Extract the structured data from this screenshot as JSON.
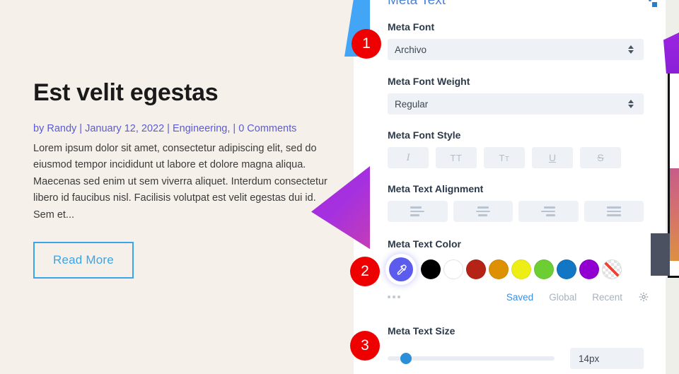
{
  "preview": {
    "post_title": "Est velit egestas",
    "meta_line": "by Randy | January 12, 2022 | Engineering, | 0 Comments",
    "excerpt": "Lorem ipsum dolor sit amet, consectetur adipiscing elit, sed do eiusmod tempor incididunt ut labore et dolore magna aliqua. Maecenas sed enim ut sem viverra aliquet. Interdum consectetur libero id faucibus nisl. Facilisis volutpat est velit egestas dui id. Sem et...",
    "read_more_label": "Read More",
    "background_color": "#f5f0ea",
    "link_color": "#5b5bd6",
    "button_color": "#3aa5e8"
  },
  "panel": {
    "title": "Meta Text",
    "title_color": "#4c82d6",
    "fields": {
      "meta_font": {
        "label": "Meta Font",
        "value": "Archivo"
      },
      "meta_font_weight": {
        "label": "Meta Font Weight",
        "value": "Regular"
      },
      "meta_font_style": {
        "label": "Meta Font Style",
        "options": [
          {
            "name": "italic",
            "glyph": "I"
          },
          {
            "name": "uppercase",
            "glyph": "TT"
          },
          {
            "name": "small-caps",
            "glyph": "T"
          },
          {
            "name": "underline",
            "glyph": "U"
          },
          {
            "name": "strikethrough",
            "glyph": "S"
          }
        ]
      },
      "meta_text_alignment": {
        "label": "Meta Text Alignment",
        "options": [
          "left",
          "center",
          "right",
          "justify"
        ]
      },
      "meta_text_color": {
        "label": "Meta Text Color",
        "swatches": [
          "#000000",
          "#ffffff",
          "#b42316",
          "#dd9000",
          "#eeee17",
          "#6cce32",
          "#1177c4",
          "#9200d1"
        ],
        "transparent_label": "none",
        "eyedropper_color": "#5b5bee",
        "tabs": [
          {
            "label": "Saved",
            "active": true
          },
          {
            "label": "Global",
            "active": false
          },
          {
            "label": "Recent",
            "active": false
          }
        ],
        "settings_icon": "gear-icon",
        "more_icon": "ellipsis-icon"
      },
      "meta_text_size": {
        "label": "Meta Text Size",
        "value": "14px",
        "thumb_percent": 11
      }
    }
  },
  "badges": [
    {
      "number": "1",
      "color": "#ef0000"
    },
    {
      "number": "2",
      "color": "#ef0000"
    },
    {
      "number": "3",
      "color": "#ef0000"
    }
  ]
}
